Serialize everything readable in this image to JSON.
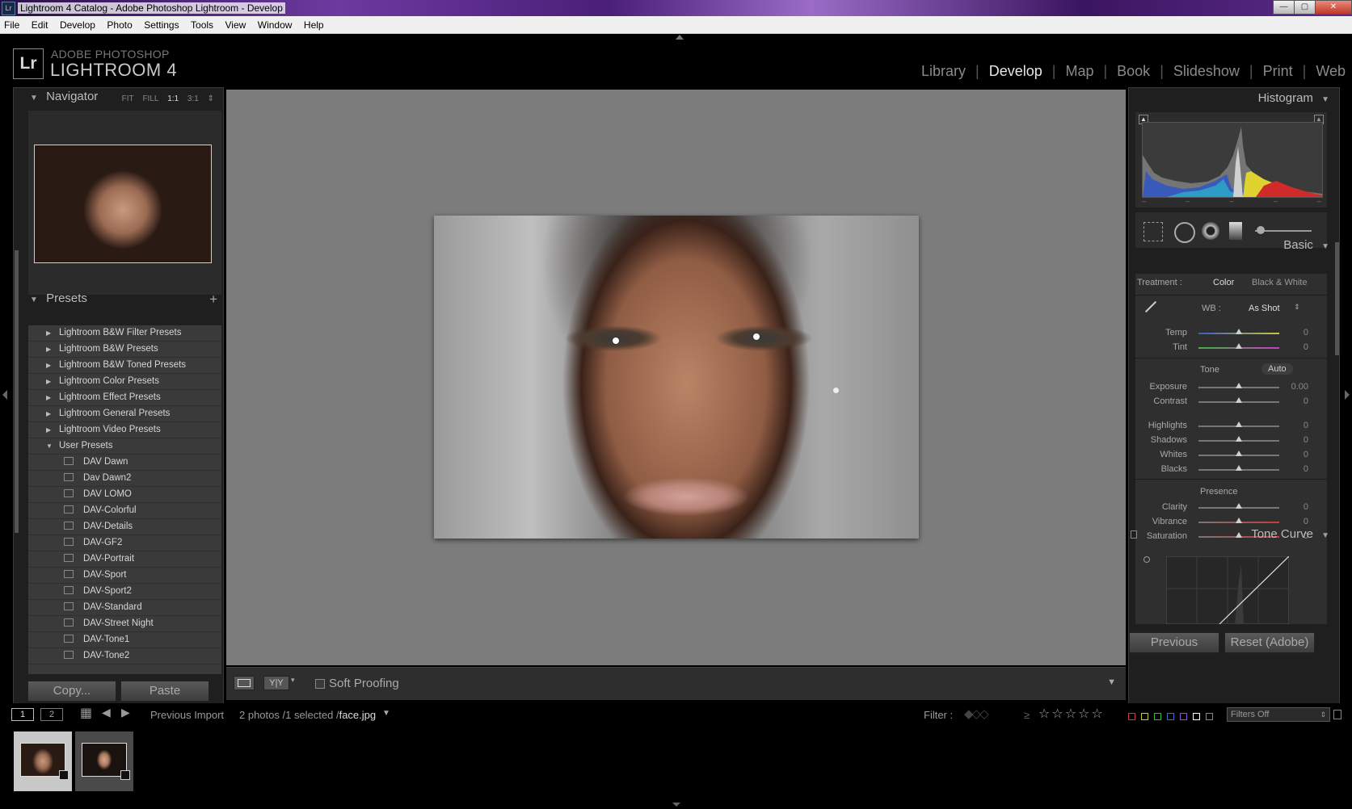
{
  "window": {
    "title": "Lightroom 4 Catalog - Adobe Photoshop Lightroom - Develop",
    "app_badge": "Lr"
  },
  "menu": [
    "File",
    "Edit",
    "Develop",
    "Photo",
    "Settings",
    "Tools",
    "View",
    "Window",
    "Help"
  ],
  "identity": {
    "logo": "Lr",
    "line1": "ADOBE PHOTOSHOP",
    "line2": "LIGHTROOM 4"
  },
  "modules": [
    {
      "label": "Library",
      "active": false
    },
    {
      "label": "Develop",
      "active": true
    },
    {
      "label": "Map",
      "active": false
    },
    {
      "label": "Book",
      "active": false
    },
    {
      "label": "Slideshow",
      "active": false
    },
    {
      "label": "Print",
      "active": false
    },
    {
      "label": "Web",
      "active": false
    }
  ],
  "navigator": {
    "title": "Navigator",
    "zoom_options": [
      "FIT",
      "FILL",
      "1:1",
      "3:1"
    ],
    "active_zoom": "1:1"
  },
  "presets": {
    "title": "Presets",
    "add_icon": "+",
    "folders": [
      {
        "label": "Lightroom B&W Filter Presets",
        "expanded": false
      },
      {
        "label": "Lightroom B&W Presets",
        "expanded": false
      },
      {
        "label": "Lightroom B&W Toned Presets",
        "expanded": false
      },
      {
        "label": "Lightroom Color Presets",
        "expanded": false
      },
      {
        "label": "Lightroom Effect Presets",
        "expanded": false
      },
      {
        "label": "Lightroom General Presets",
        "expanded": false
      },
      {
        "label": "Lightroom Video Presets",
        "expanded": false
      },
      {
        "label": "User Presets",
        "expanded": true
      }
    ],
    "user_presets": [
      "DAV Dawn",
      "Dav Dawn2",
      "DAV LOMO",
      "DAV-Colorful",
      "DAV-Details",
      "DAV-GF2",
      "DAV-Portrait",
      "DAV-Sport",
      "DAV-Sport2",
      "DAV-Standard",
      "DAV-Street Night",
      "DAV-Tone1",
      "DAV-Tone2"
    ]
  },
  "left_buttons": {
    "copy": "Copy...",
    "paste": "Paste"
  },
  "toolbar": {
    "soft_proofing": "Soft Proofing",
    "soft_proofing_checked": false
  },
  "histogram": {
    "title": "Histogram",
    "ticks": [
      "–",
      "–",
      "–",
      "–",
      "–"
    ]
  },
  "basic": {
    "title": "Basic",
    "treatment_label": "Treatment :",
    "treatment_options": [
      "Color",
      "Black & White"
    ],
    "treatment_selected": "Color",
    "wb_label": "WB :",
    "wb_value": "As Shot",
    "wb_sliders": [
      {
        "label": "Temp",
        "value": "0",
        "pos": 0.5
      },
      {
        "label": "Tint",
        "value": "0",
        "pos": 0.5
      }
    ],
    "tone_label": "Tone",
    "auto_label": "Auto",
    "tone_sliders": [
      {
        "label": "Exposure",
        "value": "0.00",
        "pos": 0.5
      },
      {
        "label": "Contrast",
        "value": "0",
        "pos": 0.5
      }
    ],
    "tone_sliders2": [
      {
        "label": "Highlights",
        "value": "0",
        "pos": 0.5
      },
      {
        "label": "Shadows",
        "value": "0",
        "pos": 0.5
      },
      {
        "label": "Whites",
        "value": "0",
        "pos": 0.5
      },
      {
        "label": "Blacks",
        "value": "0",
        "pos": 0.5
      }
    ],
    "presence_label": "Presence",
    "presence_sliders": [
      {
        "label": "Clarity",
        "value": "0",
        "pos": 0.5
      },
      {
        "label": "Vibrance",
        "value": "0",
        "pos": 0.5
      },
      {
        "label": "Saturation",
        "value": "0",
        "pos": 0.5
      }
    ]
  },
  "tone_curve": {
    "title": "Tone Curve"
  },
  "right_buttons": {
    "previous": "Previous",
    "reset": "Reset (Adobe)"
  },
  "filmstrip": {
    "screen1": "1",
    "screen2": "2",
    "source": "Previous Import",
    "count_text": "2 photos /1 selected /",
    "filename": "face.jpg",
    "filter_label": "Filter :",
    "filter_value": "Filters Off",
    "rating_op": "≥",
    "stars": [
      "☆",
      "☆",
      "☆",
      "☆",
      "☆"
    ],
    "color_labels": [
      "#c83c3c",
      "#c8c83c",
      "#3cb43c",
      "#3c6ec8",
      "#9650c8",
      "#ffffff",
      "#888888"
    ]
  }
}
